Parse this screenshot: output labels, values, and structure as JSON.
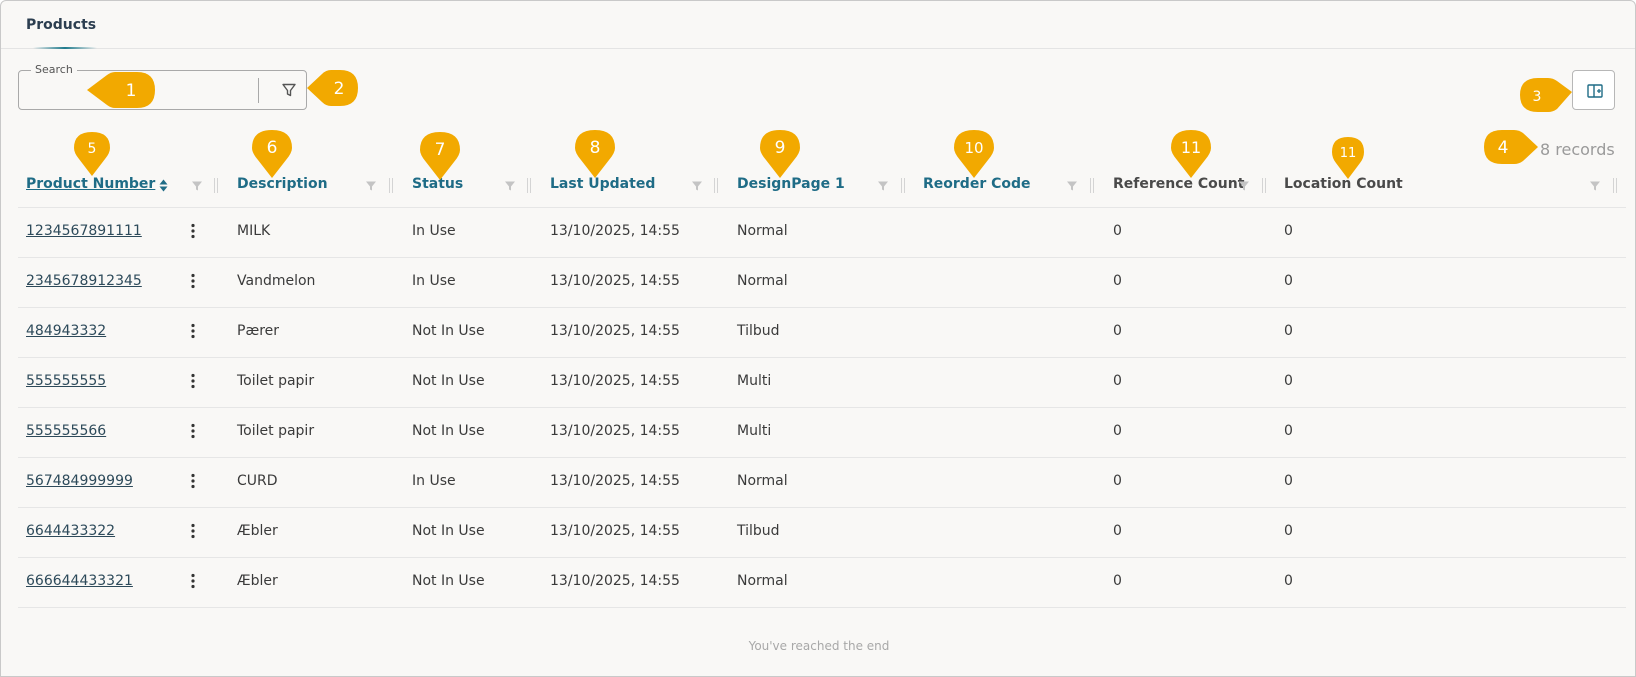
{
  "header": {
    "title": "Products"
  },
  "search": {
    "legend": "Search",
    "value": ""
  },
  "records": {
    "label": "8 records"
  },
  "columns": [
    {
      "label": "Product Number"
    },
    {
      "label": "Description"
    },
    {
      "label": "Status"
    },
    {
      "label": "Last Updated"
    },
    {
      "label": "DesignPage 1"
    },
    {
      "label": "Reorder Code"
    },
    {
      "label": "Reference Count"
    },
    {
      "label": "Location Count"
    }
  ],
  "rows": [
    {
      "product_number": "1234567891111",
      "description": "MILK",
      "status": "In Use",
      "last_updated": "13/10/2025, 14:55",
      "design_page": "Normal",
      "reorder_code": "",
      "reference_count": "0",
      "location_count": "0"
    },
    {
      "product_number": "2345678912345",
      "description": "Vandmelon",
      "status": "In Use",
      "last_updated": "13/10/2025, 14:55",
      "design_page": "Normal",
      "reorder_code": "",
      "reference_count": "0",
      "location_count": "0"
    },
    {
      "product_number": "484943332",
      "description": "Pærer",
      "status": "Not In Use",
      "last_updated": "13/10/2025, 14:55",
      "design_page": "Tilbud",
      "reorder_code": "",
      "reference_count": "0",
      "location_count": "0"
    },
    {
      "product_number": "555555555",
      "description": "Toilet papir",
      "status": "Not In Use",
      "last_updated": "13/10/2025, 14:55",
      "design_page": "Multi",
      "reorder_code": "",
      "reference_count": "0",
      "location_count": "0"
    },
    {
      "product_number": "555555566",
      "description": "Toilet papir",
      "status": "Not In Use",
      "last_updated": "13/10/2025, 14:55",
      "design_page": "Multi",
      "reorder_code": "",
      "reference_count": "0",
      "location_count": "0"
    },
    {
      "product_number": "567484999999",
      "description": "CURD",
      "status": "In Use",
      "last_updated": "13/10/2025, 14:55",
      "design_page": "Normal",
      "reorder_code": "",
      "reference_count": "0",
      "location_count": "0"
    },
    {
      "product_number": "6644433322",
      "description": "Æbler",
      "status": "Not In Use",
      "last_updated": "13/10/2025, 14:55",
      "design_page": "Tilbud",
      "reorder_code": "",
      "reference_count": "0",
      "location_count": "0"
    },
    {
      "product_number": "666644433321",
      "description": "Æbler",
      "status": "Not In Use",
      "last_updated": "13/10/2025, 14:55",
      "design_page": "Normal",
      "reorder_code": "",
      "reference_count": "0",
      "location_count": "0"
    }
  ],
  "footer": {
    "end_text": "You've reached the end"
  },
  "annotations": [
    "1",
    "2",
    "3",
    "4",
    "5",
    "6",
    "7",
    "8",
    "9",
    "10",
    "11",
    "11"
  ],
  "colors": {
    "accent": "#1f6c86",
    "marker": "#f2a900",
    "background": "#f9f8f6"
  },
  "icons": [
    "filter-icon",
    "columns-icon",
    "sort-icon",
    "kebab-menu-icon"
  ]
}
